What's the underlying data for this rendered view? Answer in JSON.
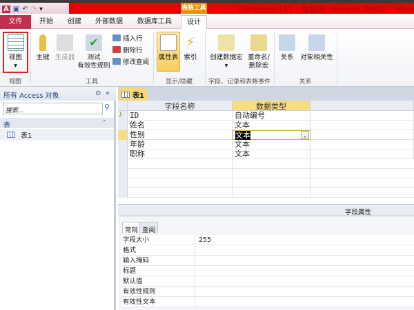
{
  "title": "Database111 : 数据库 (Access 2007) - Micros",
  "context_tab": "表格工具",
  "tabs": [
    "文件",
    "开始",
    "创建",
    "外部数据",
    "数据库工具",
    "设计"
  ],
  "ribbon": {
    "view": "视图",
    "primary_key": "主键",
    "builder": "生成器",
    "test_rules_1": "测试",
    "test_rules_2": "有效性规则",
    "insert_row": "插入行",
    "delete_row": "删除行",
    "modify_lookup": "修改查阅",
    "property_sheet": "属性表",
    "indexes": "索引",
    "create_macro": "创建数据宏",
    "rename_macro_1": "重命名/",
    "rename_macro_2": "删除宏",
    "relationships": "关系",
    "dependencies": "对象相关性",
    "groups": [
      "视图",
      "工具",
      "显示/隐藏",
      "字段、记录和表格事件",
      "关系"
    ]
  },
  "nav": {
    "header": "所有 Access 对象",
    "search_placeholder": "搜索...",
    "group": "表",
    "items": [
      "表1"
    ]
  },
  "doc_tab": "表1",
  "grid": {
    "headers": [
      "字段名称",
      "数据类型"
    ],
    "rows": [
      {
        "name": "ID",
        "type": "自动编号"
      },
      {
        "name": "姓名",
        "type": "文本"
      },
      {
        "name": "性别",
        "type": "文本"
      },
      {
        "name": "年龄",
        "type": "文本"
      },
      {
        "name": "职称",
        "type": "文本"
      }
    ]
  },
  "field_props": {
    "title": "字段属性",
    "tabs": [
      "常规",
      "查阅"
    ],
    "rows": [
      {
        "label": "字段大小",
        "value": "255"
      },
      {
        "label": "格式",
        "value": ""
      },
      {
        "label": "输入掩码",
        "value": ""
      },
      {
        "label": "标题",
        "value": ""
      },
      {
        "label": "默认值",
        "value": ""
      },
      {
        "label": "有效性规则",
        "value": ""
      },
      {
        "label": "有效性文本",
        "value": ""
      }
    ]
  }
}
